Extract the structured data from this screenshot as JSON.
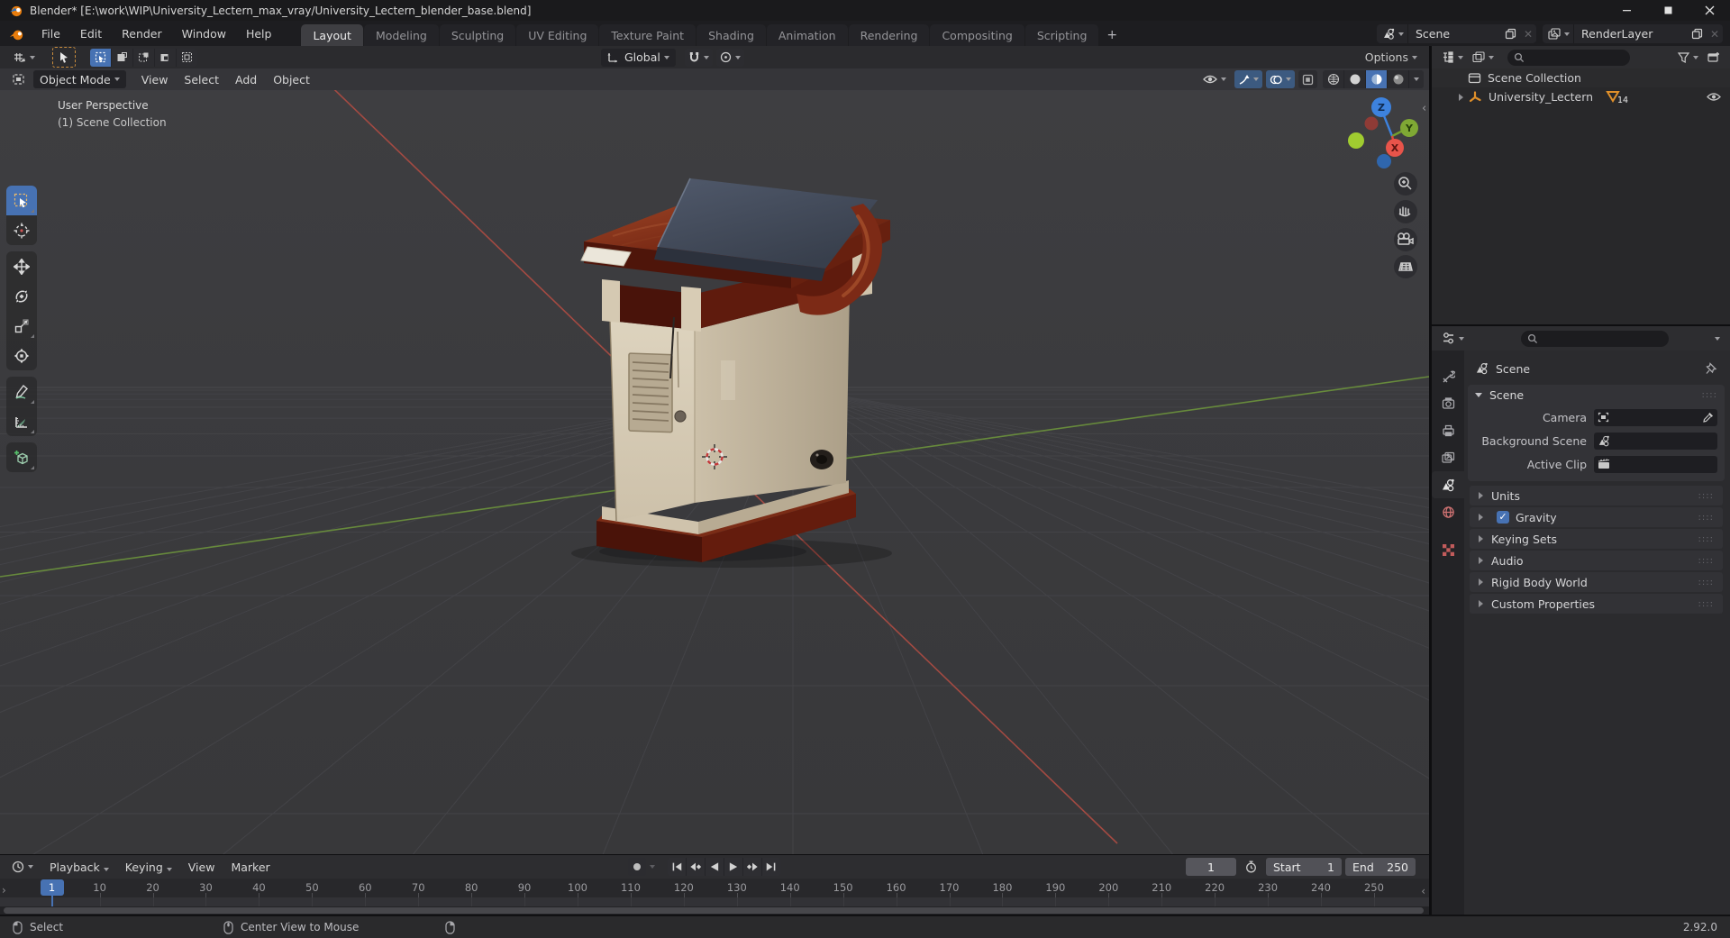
{
  "titlebar": {
    "title": "Blender* [E:\\work\\WIP\\University_Lectern_max_vray/University_Lectern_blender_base.blend]"
  },
  "topbar": {
    "menus": [
      "File",
      "Edit",
      "Render",
      "Window",
      "Help"
    ],
    "tabs": [
      "Layout",
      "Modeling",
      "Sculpting",
      "UV Editing",
      "Texture Paint",
      "Shading",
      "Animation",
      "Rendering",
      "Compositing",
      "Scripting"
    ],
    "active_tab": "Layout",
    "new_tab_label": "+",
    "scene_selector": {
      "value": "Scene"
    },
    "render_layer_selector": {
      "value": "RenderLayer"
    }
  },
  "tool_settings": {
    "orientation": "Global",
    "options_label": "Options"
  },
  "viewport_header": {
    "mode": "Object Mode",
    "menus": [
      "View",
      "Select",
      "Add",
      "Object"
    ]
  },
  "viewport": {
    "overlay_line1": "User Perspective",
    "overlay_line2": "(1) Scene Collection",
    "gizmo_axes": {
      "x": "X",
      "y": "Y",
      "z": "Z"
    }
  },
  "toolbar_tools": [
    "select-box",
    "cursor",
    "move",
    "rotate",
    "scale",
    "transform",
    "annotate",
    "measure",
    "add-cube"
  ],
  "outliner": {
    "rows": [
      {
        "label": "Scene Collection"
      },
      {
        "label": "University_Lectern",
        "badge": "14"
      }
    ]
  },
  "properties": {
    "breadcrumb": "Scene",
    "panel_title": "Scene",
    "fields": [
      {
        "label": "Camera"
      },
      {
        "label": "Background Scene"
      },
      {
        "label": "Active Clip"
      }
    ],
    "panels": [
      {
        "label": "Units"
      },
      {
        "label": "Gravity",
        "checkbox": true
      },
      {
        "label": "Keying Sets"
      },
      {
        "label": "Audio"
      },
      {
        "label": "Rigid Body World"
      },
      {
        "label": "Custom Properties"
      }
    ]
  },
  "timeline": {
    "menus": [
      "Playback",
      "Keying",
      "View",
      "Marker"
    ],
    "current_frame": "1",
    "frame_field_value": "1",
    "start_label": "Start",
    "start_value": "1",
    "end_label": "End",
    "end_value": "250",
    "ruler_frames": [
      1,
      10,
      20,
      30,
      40,
      50,
      60,
      70,
      80,
      90,
      100,
      110,
      120,
      130,
      140,
      150,
      160,
      170,
      180,
      190,
      200,
      210,
      220,
      230,
      240,
      250
    ]
  },
  "statusbar": {
    "left_hint": "Select",
    "middle_hint": "Center View to Mouse",
    "version": "2.92.0"
  }
}
